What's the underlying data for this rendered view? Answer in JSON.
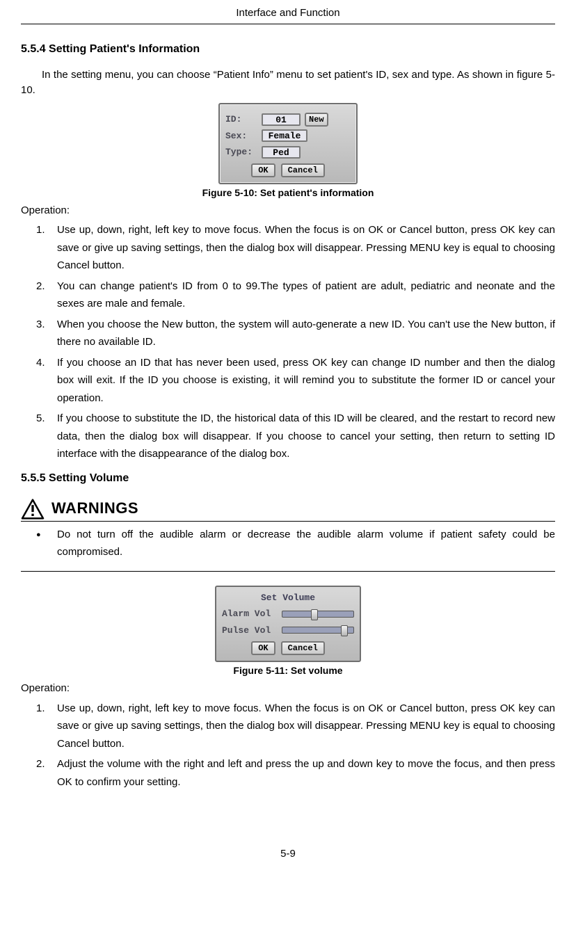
{
  "header": "Interface and Function",
  "s1": {
    "heading": "5.5.4 Setting Patient's Information",
    "intro": "In the setting menu, you can choose “Patient Info” menu to set patient's ID, sex and type. As shown in figure 5-10.",
    "dialog": {
      "id_label": "ID:",
      "id_value": "01",
      "new_btn": "New",
      "sex_label": "Sex:",
      "sex_value": "Female",
      "type_label": "Type:",
      "type_value": "Ped",
      "ok": "OK",
      "cancel": "Cancel"
    },
    "caption": "Figure 5-10: Set patient's information",
    "op_label": "Operation:",
    "steps": [
      "Use up, down, right, left key to move focus. When the focus is on OK or Cancel button, press OK key can save or give up saving settings, then the dialog box will disappear. Pressing MENU key is equal to choosing Cancel button.",
      "You can change patient's ID from 0 to 99.The types of patient are adult, pediatric and neonate and the sexes are male and female.",
      "When you choose the New button, the system will auto-generate a new ID. You can't use the New button, if there no available ID.",
      "If you choose an ID that has never been used, press OK key can change ID number and then the dialog box will exit. If the ID you choose is existing, it will remind you to substitute the former ID or cancel your operation.",
      "If you choose to substitute the ID, the historical data of this ID will be cleared, and the restart to record new data, then the dialog box will disappear. If you choose to cancel your setting, then return to setting ID interface with the disappearance of the dialog box."
    ]
  },
  "s2": {
    "heading": "5.5.5 Setting Volume",
    "warnings_label": "WARNINGS",
    "warning_item": "Do not turn off the audible alarm or decrease the audible alarm volume if patient safety could be compromised.",
    "dialog": {
      "title": "Set Volume",
      "alarm_label": "Alarm Vol",
      "pulse_label": "Pulse Vol",
      "ok": "OK",
      "cancel": "Cancel"
    },
    "caption": "Figure 5-11: Set volume",
    "op_label": "Operation:",
    "steps": [
      "Use up, down, right, left key to move focus. When the focus is on OK or Cancel button, press OK key can save or give up saving settings, then the dialog box will disappear. Pressing MENU key is equal to choosing Cancel button.",
      "Adjust the volume with the right and left and press the up and down key to move the focus, and then press OK to confirm your setting."
    ]
  },
  "footer": "5-9"
}
